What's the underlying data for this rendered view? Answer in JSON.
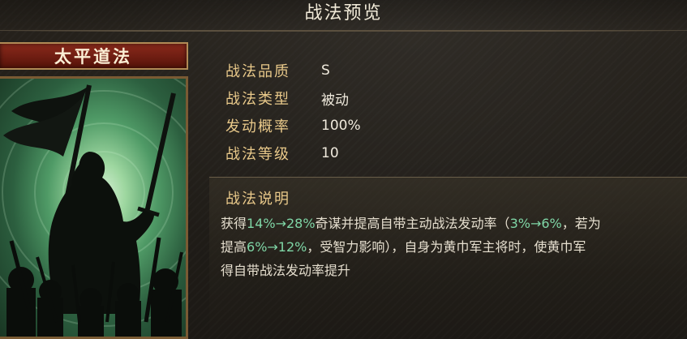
{
  "panel": {
    "title": "战法预览"
  },
  "card": {
    "name": "太平道法",
    "art_icon": "banner-warrior-silhouette"
  },
  "attributes": [
    {
      "label": "战法品质",
      "value": "S"
    },
    {
      "label": "战法类型",
      "value": "被动"
    },
    {
      "label": "发动概率",
      "value": "100%"
    },
    {
      "label": "战法等级",
      "value": "10"
    }
  ],
  "description": {
    "title": "战法说明",
    "line1": {
      "p1": "获得",
      "h1": "14%→28%",
      "p2": "奇谋并提高自带主动战法发动率（",
      "h2": "3%→6%",
      "p3": "，若为"
    },
    "line2": {
      "p1": "提高",
      "h1": "6%→12%",
      "p2": "，受智力影响），自身为黄巾军主将时，使黄巾军"
    },
    "line3": "得自带战法发动率提升"
  },
  "colors": {
    "label": "#e9c98a",
    "highlight": "#7fd6a6",
    "banner": "#7a2316"
  }
}
